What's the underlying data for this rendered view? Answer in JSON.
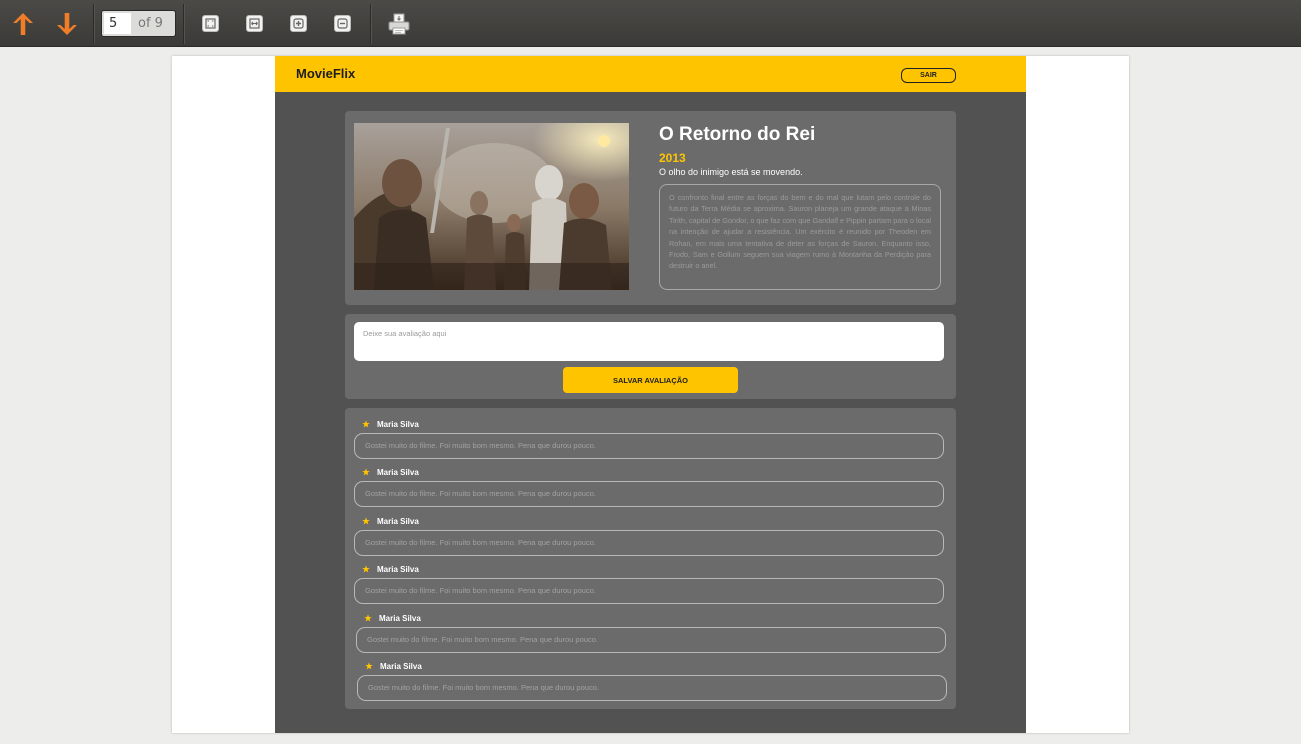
{
  "viewer": {
    "current_page": "5",
    "total_pages": "of 9"
  },
  "app": {
    "brand": "MovieFlix",
    "logout_label": "SAIR"
  },
  "movie": {
    "title": "O Retorno do Rei",
    "year": "2013",
    "subtitle": "O olho do inimigo está se movendo.",
    "synopsis": "O confronto final entre as forças do bem e do mal que lutam pelo controle do futuro da Terra Média se aproxima. Sauron planeja um grande ataque a Minas Tirith, capital de Gondor, o que faz com que Gandalf e Pippin partam para o local na intenção de ajudar a resistência. Um exército é reunido por Theoden em Rohan, em mais uma tentativa de deter as forças de Sauron. Enquanto isso, Frodo, Sam e Gollum seguem sua viagem rumo à Montanha da Perdição para destruir o anel."
  },
  "review_form": {
    "placeholder": "Deixe sua avaliação aqui",
    "save_label": "SALVAR AVALIAÇÃO"
  },
  "reviews": [
    {
      "author": "Maria Silva",
      "text": "Gostei muito do filme. Foi muito bom mesmo. Pena que durou pouco."
    },
    {
      "author": "Maria Silva",
      "text": "Gostei muito do filme. Foi muito bom mesmo. Pena que durou pouco."
    },
    {
      "author": "Maria Silva",
      "text": "Gostei muito do filme. Foi muito bom mesmo. Pena que durou pouco."
    },
    {
      "author": "Maria Silva",
      "text": "Gostei muito do filme. Foi muito bom mesmo. Pena que durou pouco."
    },
    {
      "author": "Maria Silva",
      "text": "Gostei muito do filme. Foi muito bom mesmo. Pena que durou pouco."
    },
    {
      "author": "Maria Silva",
      "text": "Gostei muito do filme. Foi muito bom mesmo. Pena que durou pouco."
    }
  ],
  "colors": {
    "accent": "#ffc400",
    "app_background": "#525252",
    "card_background": "#6b6b6b"
  },
  "icons": {
    "prev_page": "arrow-up-icon",
    "next_page": "arrow-down-icon",
    "fit_page": "fit-page-icon",
    "fit_width": "fit-width-icon",
    "zoom_in": "zoom-in-icon",
    "zoom_out": "zoom-out-icon",
    "print": "print-icon",
    "review_star": "star-icon"
  }
}
